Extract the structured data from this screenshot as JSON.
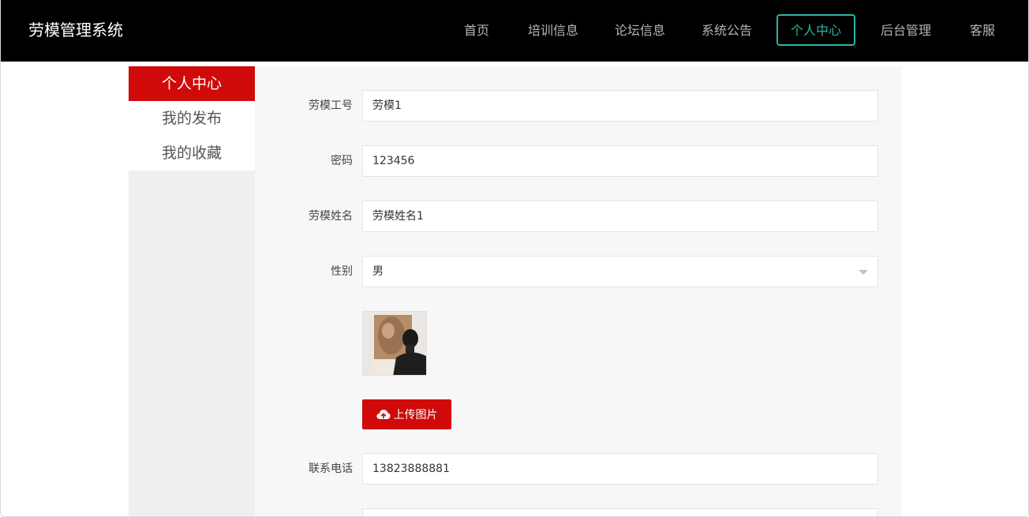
{
  "header": {
    "brand": "劳模管理系统",
    "nav": [
      {
        "label": "首页"
      },
      {
        "label": "培训信息"
      },
      {
        "label": "论坛信息"
      },
      {
        "label": "系统公告"
      },
      {
        "label": "个人中心",
        "active": true
      },
      {
        "label": "后台管理"
      },
      {
        "label": "客服"
      }
    ]
  },
  "sidebar": {
    "items": [
      {
        "label": "个人中心",
        "active": true
      },
      {
        "label": "我的发布"
      },
      {
        "label": "我的收藏"
      }
    ]
  },
  "form": {
    "worker_id": {
      "label": "劳模工号",
      "value": "劳模1"
    },
    "password": {
      "label": "密码",
      "value": "123456"
    },
    "name": {
      "label": "劳模姓名",
      "value": "劳模姓名1"
    },
    "gender": {
      "label": "性别",
      "value": "男"
    },
    "upload": {
      "label": "上传图片",
      "icon": "cloud-upload-icon"
    },
    "phone": {
      "label": "联系电话",
      "value": "13823888881"
    }
  },
  "colors": {
    "header_bg": "#000000",
    "active_nav": "#2bb5a6",
    "accent_red": "#d00a0a",
    "main_bg": "#f7f7f7",
    "sidebar_bg": "#efefef"
  }
}
